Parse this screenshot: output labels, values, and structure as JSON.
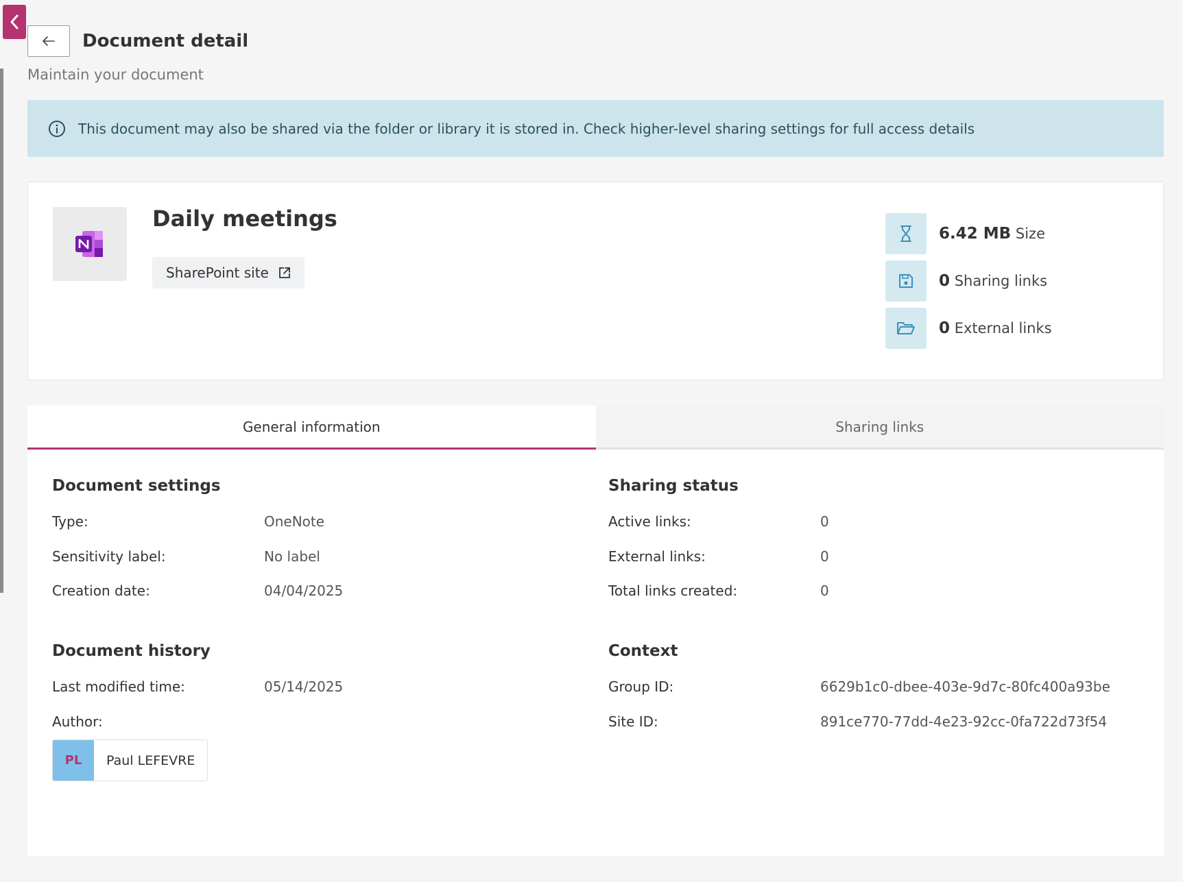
{
  "header": {
    "title": "Document detail",
    "subtitle": "Maintain your document"
  },
  "banner": {
    "text": "This document may also be shared via the folder or library it is stored in. Check higher-level sharing settings for full access details"
  },
  "document": {
    "name": "Daily meetings",
    "sharepoint_label": "SharePoint site",
    "stats": [
      {
        "value": "6.42 MB",
        "label": "Size",
        "icon": "hourglass-icon"
      },
      {
        "value": "0",
        "label": "Sharing links",
        "icon": "save-icon"
      },
      {
        "value": "0",
        "label": "External links",
        "icon": "folder-open-icon"
      }
    ]
  },
  "tabs": [
    {
      "label": "General information",
      "active": true
    },
    {
      "label": "Sharing links",
      "active": false
    }
  ],
  "document_settings": {
    "title": "Document settings",
    "rows": [
      {
        "label": "Type:",
        "value": "OneNote"
      },
      {
        "label": "Sensitivity label:",
        "value": "No label"
      },
      {
        "label": "Creation date:",
        "value": "04/04/2025"
      }
    ]
  },
  "document_history": {
    "title": "Document history",
    "last_modified_label": "Last modified time:",
    "last_modified_value": "05/14/2025",
    "author_label": "Author:",
    "author_initials": "PL",
    "author_name": "Paul LEFEVRE"
  },
  "sharing_status": {
    "title": "Sharing status",
    "rows": [
      {
        "label": "Active links:",
        "value": "0"
      },
      {
        "label": "External links:",
        "value": "0"
      },
      {
        "label": "Total links created:",
        "value": "0"
      }
    ]
  },
  "context": {
    "title": "Context",
    "rows": [
      {
        "label": "Group ID:",
        "value": "6629b1c0-dbee-403e-9d7c-80fc400a93be"
      },
      {
        "label": "Site ID:",
        "value": "891ce770-77dd-4e23-92cc-0fa722d73f54"
      }
    ]
  },
  "colors": {
    "accent": "#b5336f",
    "banner_bg": "#cde4ec",
    "stat_icon_bg": "#d5e9f1",
    "stat_icon_fg": "#3f8fb8",
    "avatar_bg": "#7ec0ea"
  }
}
